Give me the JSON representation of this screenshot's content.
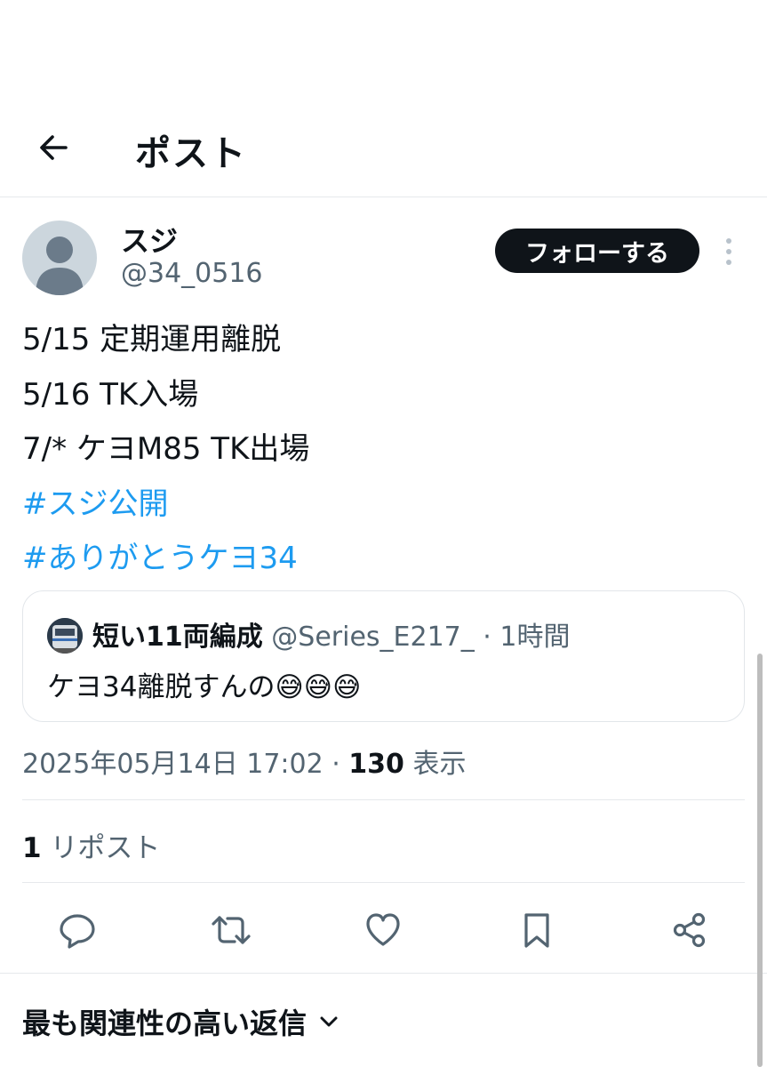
{
  "header": {
    "title": "ポスト"
  },
  "author": {
    "name": "スジ",
    "handle": "@34_0516"
  },
  "follow_label": "フォローする",
  "post": {
    "lines": [
      "5/15 定期運用離脱",
      "5/16 TK入場",
      "7/* ケヨM85 TK出場"
    ],
    "hashtags": [
      "#スジ公開",
      "#ありがとうケヨ34"
    ]
  },
  "quote": {
    "name": "短い11両編成",
    "meta": "@Series_E217_ · 1時間",
    "text": "ケヨ34離脱すんの😅😅😅"
  },
  "meta": {
    "date": "2025年05月14日 17:02",
    "sep": " · ",
    "views": "130",
    "views_label": "表示"
  },
  "reposts": {
    "count": "1",
    "label": "リポスト"
  },
  "replies_sort": {
    "label": "最も関連性の高い返信"
  },
  "colors": {
    "accent": "#1d9bf0",
    "text": "#0f1419",
    "secondary": "#536471",
    "follow_bg": "#0f1419"
  },
  "icons": [
    "arrow-left-icon",
    "more-vertical-icon",
    "reply-icon",
    "repost-icon",
    "like-icon",
    "bookmark-icon",
    "share-icon",
    "chevron-down-icon"
  ]
}
